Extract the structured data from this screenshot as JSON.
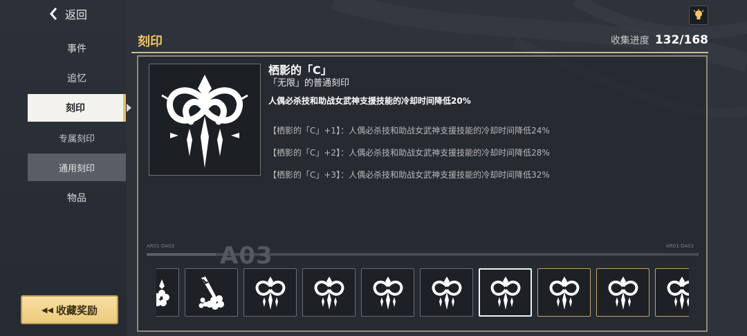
{
  "nav": {
    "back_label": "返回",
    "items": [
      {
        "label": "事件"
      },
      {
        "label": "追忆"
      },
      {
        "label": "刻印",
        "active": true
      },
      {
        "label": "专属刻印"
      },
      {
        "label": "通用刻印",
        "sub_active": true
      },
      {
        "label": "物品"
      }
    ]
  },
  "reward_button": {
    "label": "收藏奖励"
  },
  "header": {
    "section_title": "刻印",
    "progress_label": "收集进度",
    "progress_value": "132/168",
    "hint_icon": "lightbulb-icon"
  },
  "stigmata": {
    "name": "栖影的「C」",
    "type": "「无限」的普通刻印",
    "description": "人偶必杀技和助战女武神支援技能的冷却时间降低20%",
    "bonuses": [
      "【栖影的「C」+1】：人偶必杀技和助战女武神支援技能的冷却时间降低24%",
      "【栖影的「C」+2】：人偶必杀技和助战女武神支援技能的冷却时间降低28%",
      "【栖影的「C」+3】：人偶必杀技和助战女武神支援技能的冷却时间降低32%"
    ]
  },
  "timeline": {
    "left_tag": "AR01-DA03",
    "center_code": "A03",
    "right_tag": "AR01-DA03"
  },
  "strip_icons": [
    "sakura-emblem-icon",
    "sakura-sword-emblem-icon",
    "serpent-emblem-icon",
    "serpent-emblem-icon",
    "serpent-emblem-icon",
    "serpent-emblem-icon",
    "serpent-emblem-icon",
    "serpent-emblem-icon",
    "serpent-emblem-icon",
    "serpent-emblem-icon"
  ],
  "colors": {
    "accent_gold": "#f0c66a",
    "reward_button": "#eccb7c",
    "active_nav": "#f4f2ec"
  }
}
